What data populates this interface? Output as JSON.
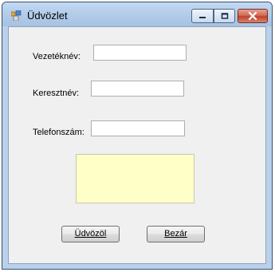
{
  "window": {
    "title": "Üdvözlet"
  },
  "title_buttons": {
    "minimize": "minimize-icon",
    "maximize": "maximize-icon",
    "close": "close-icon"
  },
  "form": {
    "last_name_label": "Vezetéknév:",
    "last_name_value": "",
    "first_name_label": "Keresztnév:",
    "first_name_value": "",
    "phone_label": "Telefonszám:",
    "phone_value": "",
    "output_text": ""
  },
  "buttons": {
    "greet_label": "Üdvözöl",
    "close_label": "Bezár"
  },
  "colors": {
    "output_background": "#ffffc8",
    "client_background": "#f0f0f0",
    "close_button": "#c2412c"
  }
}
